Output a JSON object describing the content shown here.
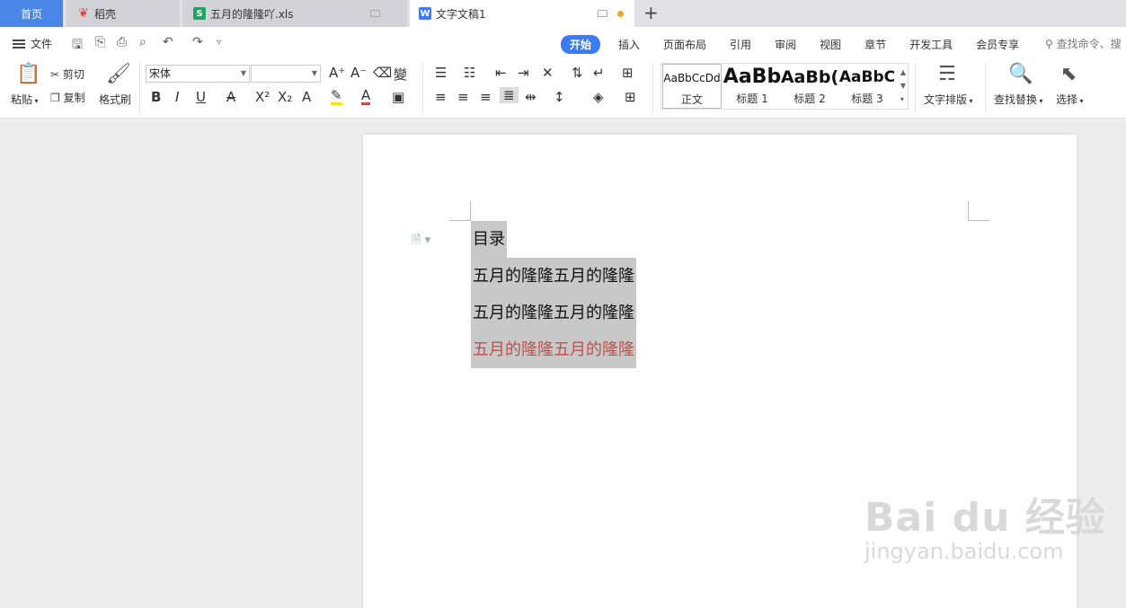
{
  "tabs": {
    "home": "首页",
    "tab1": "稻壳",
    "tab2": "五月的隆隆吖.xls",
    "tab3": "文字文稿1",
    "new_tab": "+"
  },
  "menu": {
    "file": "文件",
    "ribbon_tabs": [
      "开始",
      "插入",
      "页面布局",
      "引用",
      "审阅",
      "视图",
      "章节",
      "开发工具",
      "会员专享"
    ],
    "search_placeholder": "查找命令、搜"
  },
  "ribbon": {
    "paste": "粘贴",
    "cut": "剪切",
    "copy": "复制",
    "format_painter": "格式刷",
    "font_name": "宋体",
    "font_size": "",
    "styles": [
      {
        "preview": "AaBbCcDd",
        "label": "正文"
      },
      {
        "preview": "AaBb",
        "label": "标题 1"
      },
      {
        "preview": "AaBb(",
        "label": "标题 2"
      },
      {
        "preview": "AaBbC",
        "label": "标题 3"
      }
    ],
    "text_layout": "文字排版",
    "find_replace": "查找替换",
    "select": "选择"
  },
  "document": {
    "lines": [
      {
        "text": "目录",
        "color": "#111111"
      },
      {
        "text": "五月的隆隆五月的隆隆",
        "color": "#111111"
      },
      {
        "text": "五月的隆隆五月的隆隆",
        "color": "#111111"
      },
      {
        "text": "五月的隆隆五月的隆隆",
        "color": "#c0504d"
      }
    ],
    "selection_color": "#c8c8c8"
  },
  "watermark": {
    "brand": "Bai du 经验",
    "url": "jingyan.baidu.com"
  },
  "colors": {
    "accent": "#3d7bf5",
    "home_tab": "#4a86e8",
    "unsaved_dot": "#f0a127"
  }
}
